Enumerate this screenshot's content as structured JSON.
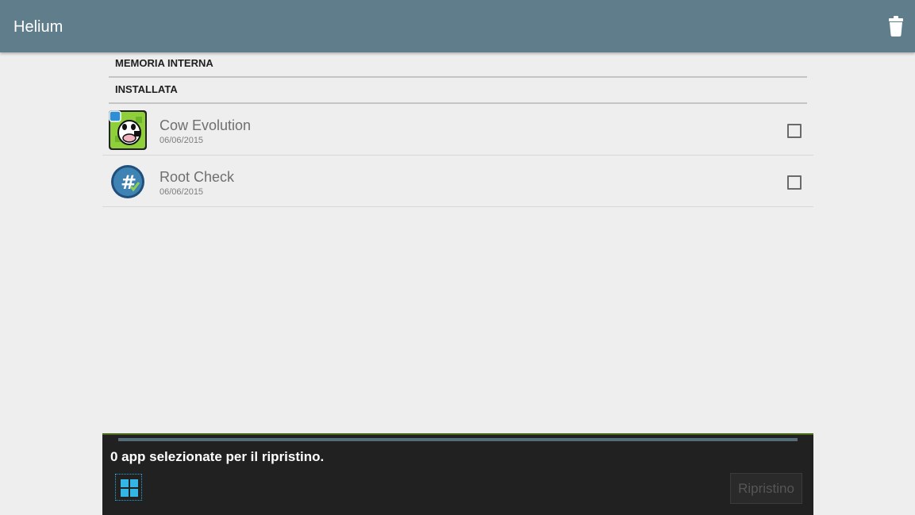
{
  "app": {
    "title": "Helium"
  },
  "toolbar": {
    "delete_icon": "trash-icon"
  },
  "sections": [
    {
      "label": "MEMORIA INTERNA"
    },
    {
      "label": "INSTALLATA"
    }
  ],
  "apps": [
    {
      "name": "Cow Evolution",
      "date": "06/06/2015",
      "icon": "cow-evolution-icon",
      "checked": false
    },
    {
      "name": "Root Check",
      "date": "06/06/2015",
      "icon": "root-check-icon",
      "checked": false
    }
  ],
  "footer": {
    "status": "0 app selezionate per il ripristino.",
    "restore_label": "Ripristino",
    "select_all_icon": "select-all-icon"
  },
  "colors": {
    "appbar": "#607d8b",
    "accent": "#34b5e5",
    "footer_bg": "#212121"
  }
}
